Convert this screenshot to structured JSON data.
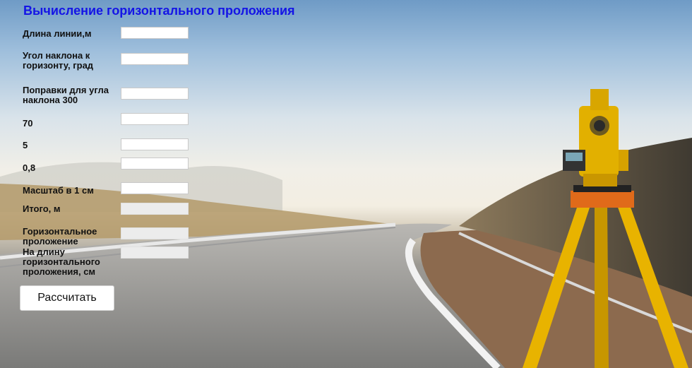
{
  "title": "Вычисление горизонтального проложения",
  "fields": [
    {
      "label": "Длина линии,м",
      "value": "",
      "readonly": false
    },
    {
      "label": "Угол наклона к горизонту, град",
      "value": "",
      "readonly": false
    },
    {
      "label": "Поправки для угла наклона 300",
      "value": "",
      "readonly": false
    },
    {
      "label": "70",
      "value": "",
      "readonly": false
    },
    {
      "label": "5",
      "value": "",
      "readonly": false
    },
    {
      "label": "0,8",
      "value": "",
      "readonly": false
    },
    {
      "label": "Масштаб в 1 см",
      "value": "",
      "readonly": false
    },
    {
      "label": "Итого, м",
      "value": "",
      "readonly": true
    },
    {
      "label": "Горизонтальное проложение",
      "value": "",
      "readonly": true
    },
    {
      "label": "На длину горизонтального проложения, см",
      "value": "",
      "readonly": true
    }
  ],
  "button": {
    "label": "Рассчитать"
  },
  "colors": {
    "title": "#1414e6"
  }
}
